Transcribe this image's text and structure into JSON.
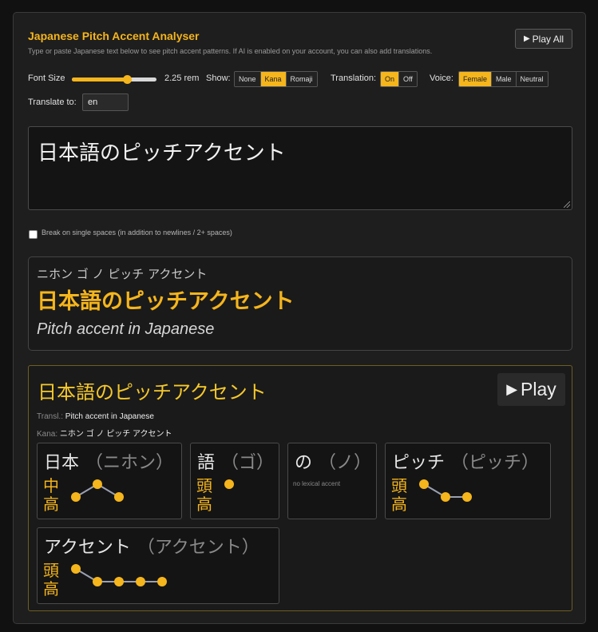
{
  "app": {
    "title": "Japanese Pitch Accent Analyser",
    "subtitle": "Type or paste Japanese text below to see pitch accent patterns. If AI is enabled on your account, you can also add translations.",
    "play_all_label": "Play All"
  },
  "controls": {
    "font_size_label": "Font Size",
    "font_size_value": "2.25 rem",
    "font_size_level": 0.65,
    "show_label": "Show:",
    "show_options": [
      "None",
      "Kana",
      "Romaji"
    ],
    "show_selected": "Kana",
    "translation_label": "Translation:",
    "translation_options": [
      "On",
      "Off"
    ],
    "translation_selected": "On",
    "voice_label": "Voice:",
    "voice_options": [
      "Female",
      "Male",
      "Neutral"
    ],
    "voice_selected": "Female",
    "translate_to_label": "Translate to:",
    "translate_to_value": "en"
  },
  "input": {
    "text": "日本語のピッチアクセント",
    "break_on_spaces_label": "Break on single spaces (in addition to newlines / 2+ spaces)",
    "break_on_spaces_checked": false
  },
  "result": {
    "kana": "ニホン ゴ ノ ピッチ アクセント",
    "text": "日本語のピッチアクセント",
    "translation": "Pitch accent in Japanese"
  },
  "detail": {
    "title": "日本語のピッチアクセント",
    "play_label": "Play",
    "transl_key": "Transl.:",
    "transl_value": "Pitch accent in Japanese",
    "kana_key": "Kana:",
    "kana_value": "ニホン ゴ ノ ピッチ アクセント",
    "words": [
      {
        "word": "日本",
        "reading": "（ニホン）",
        "accent": "中高",
        "pitch": [
          0,
          1,
          0
        ]
      },
      {
        "word": "語",
        "reading": "（ゴ）",
        "accent": "頭高",
        "pitch": [
          1
        ]
      },
      {
        "word": "の",
        "reading": "（ノ）",
        "accent": "",
        "pitch": [],
        "note": "no lexical accent"
      },
      {
        "word": "ピッチ",
        "reading": "（ピッチ）",
        "accent": "頭高",
        "pitch": [
          1,
          0,
          0
        ]
      },
      {
        "word": "アクセント",
        "reading": "（アクセント）",
        "accent": "頭高",
        "pitch": [
          1,
          0,
          0,
          0,
          0
        ]
      }
    ]
  },
  "colors": {
    "accent": "#f5b51c",
    "panel_bg": "#1e1e1e",
    "detail_border": "#6e5e22"
  },
  "icons": {
    "play": "play-icon"
  }
}
